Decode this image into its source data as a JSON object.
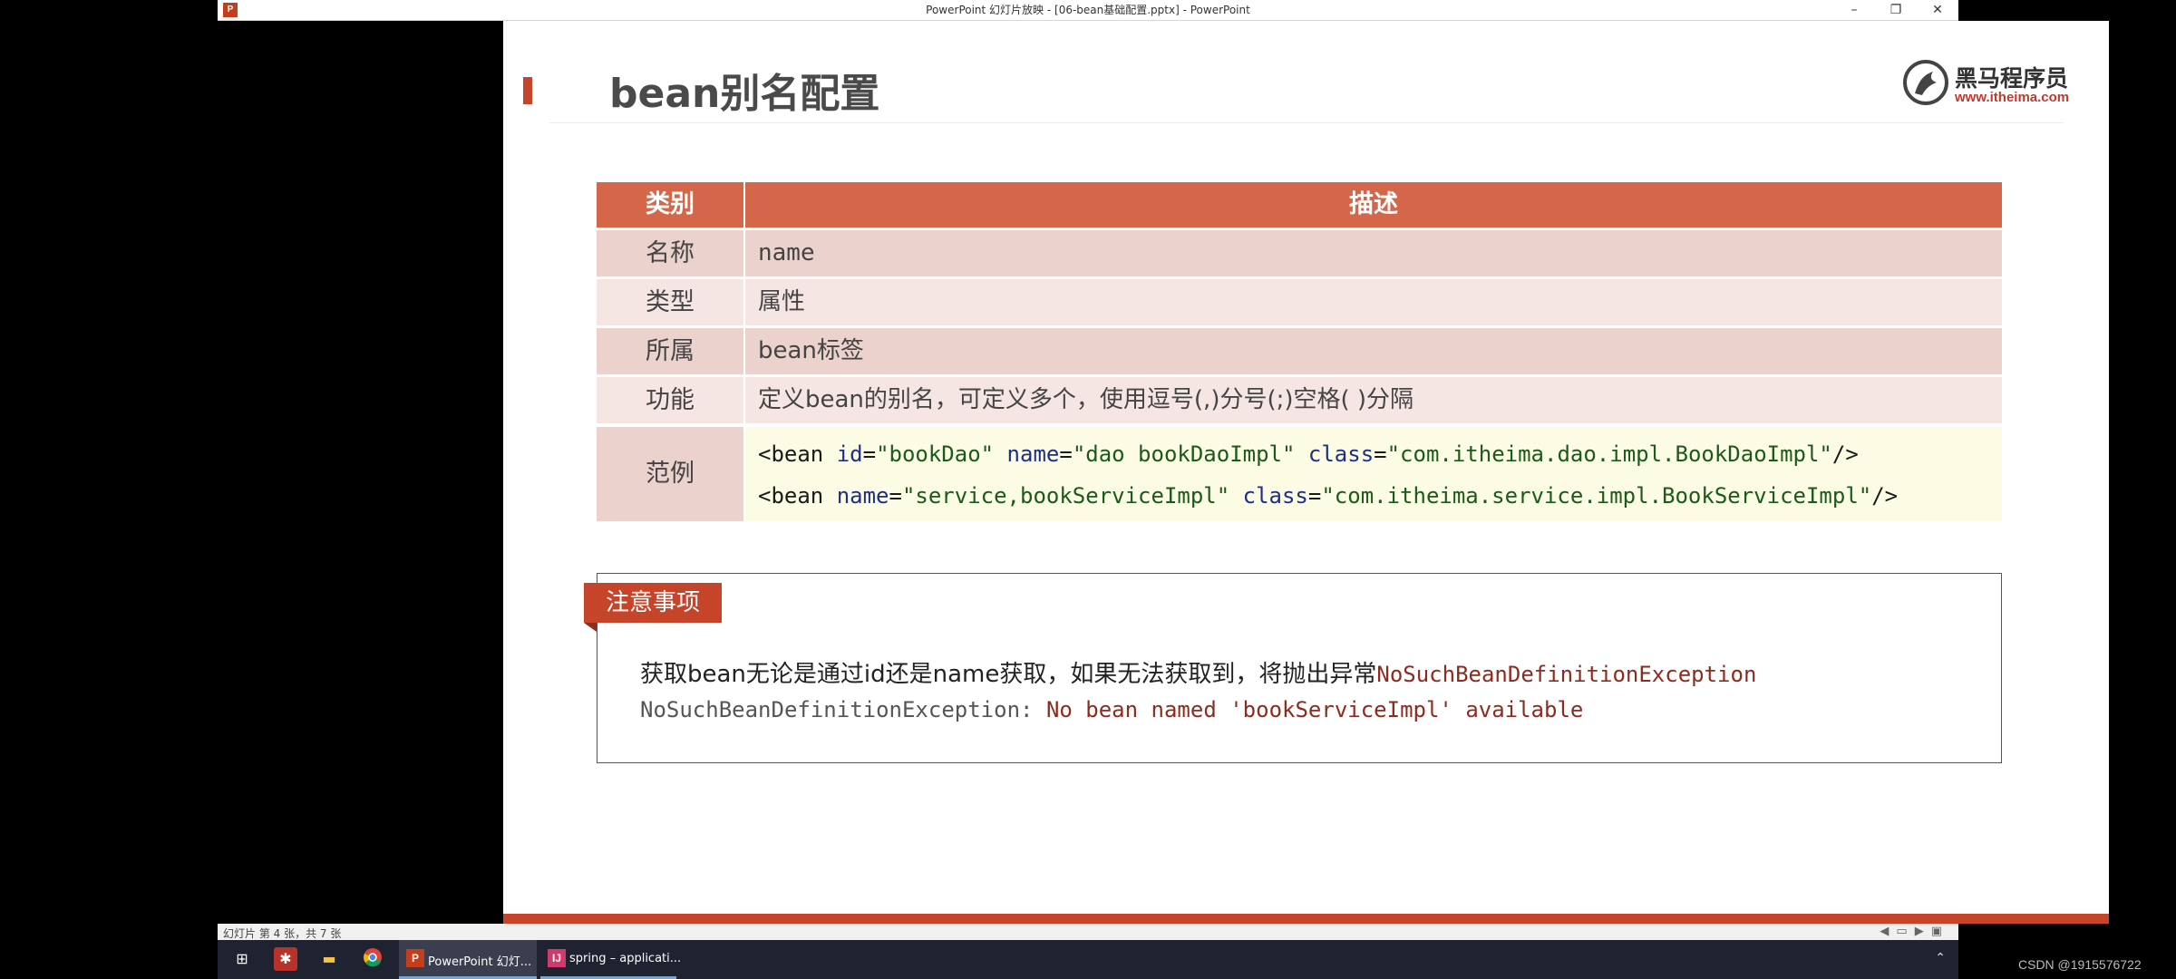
{
  "window": {
    "title": "PowerPoint 幻灯片放映 - [06-bean基础配置.pptx] - PowerPoint",
    "app_icon_label": "P",
    "min_label": "–",
    "max_label": "❐",
    "close_label": "✕"
  },
  "slide": {
    "title": "bean别名配置",
    "logo": {
      "name": "黑马程序员",
      "url": "www.itheima.com"
    },
    "table": {
      "header": {
        "category": "类别",
        "description": "描述"
      },
      "rows": [
        {
          "category": "名称",
          "description": "name"
        },
        {
          "category": "类型",
          "description": "属性"
        },
        {
          "category": "所属",
          "description": "bean标签"
        },
        {
          "category": "功能",
          "description": "定义bean的别名，可定义多个，使用逗号(,)分号(;)空格( )分隔"
        }
      ],
      "example": {
        "category": "范例",
        "line1": {
          "open": "<bean ",
          "attr1": "id",
          "eq1": "=",
          "val1": "\"bookDao\"",
          "attr2": " name",
          "eq2": "=",
          "val2": "\"dao bookDaoImpl\"",
          "attr3": " class",
          "eq3": "=",
          "val3": "\"com.itheima.dao.impl.BookDaoImpl\"",
          "close": "/>"
        },
        "line2": {
          "open": "<bean ",
          "attr1": "name",
          "eq1": "=",
          "val1": "\"service,bookServiceImpl\"",
          "attr2": " class",
          "eq2": "=",
          "val2": "\"com.itheima.service.impl.BookServiceImpl\"",
          "close": "/>"
        }
      }
    },
    "notice": {
      "tab_label": "注意事项",
      "line1_text": "获取bean无论是通过id还是name获取，如果无法获取到，将抛出异常",
      "line1_exception": "NoSuchBeanDefinitionException",
      "line2_prefix": "NoSuchBeanDefinitionException: ",
      "line2_message": "No bean named 'bookServiceImpl' available"
    }
  },
  "status_bar": {
    "text": "幻灯片 第 4 张，共 7 张"
  },
  "taskbar": {
    "tasks": [
      {
        "label": "PowerPoint 幻灯...",
        "icon": "P"
      },
      {
        "label": "spring – applicati...",
        "icon": "IJ"
      }
    ]
  },
  "watermark": "CSDN @1915576722",
  "colors": {
    "accent": "#c6442a",
    "table_header": "#d4674a",
    "row_odd": "#ebd2cd",
    "row_even": "#f5e6e3",
    "code_bg": "#fcfbe4"
  }
}
